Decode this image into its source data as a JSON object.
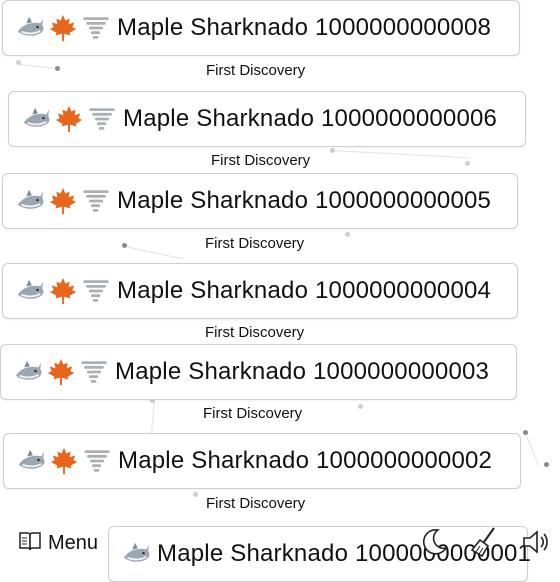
{
  "elements": [
    {
      "emojis": [
        "shark",
        "maple-leaf",
        "tornado"
      ],
      "name": "Maple Sharknado 1000000000008",
      "caption": "First Discovery"
    },
    {
      "emojis": [
        "shark",
        "maple-leaf",
        "tornado"
      ],
      "name": "Maple Sharknado 1000000000006",
      "caption": "First Discovery"
    },
    {
      "emojis": [
        "shark",
        "maple-leaf",
        "tornado"
      ],
      "name": "Maple Sharknado 1000000000005",
      "caption": "First Discovery"
    },
    {
      "emojis": [
        "shark",
        "maple-leaf",
        "tornado"
      ],
      "name": "Maple Sharknado 1000000000004",
      "caption": "First Discovery"
    },
    {
      "emojis": [
        "shark",
        "maple-leaf",
        "tornado"
      ],
      "name": "Maple Sharknado 1000000000003",
      "caption": "First Discovery"
    },
    {
      "emojis": [
        "shark",
        "maple-leaf",
        "tornado"
      ],
      "name": "Maple Sharknado 1000000000002",
      "caption": "First Discovery"
    },
    {
      "emojis": [
        "shark",
        "maple-leaf",
        "tornado"
      ],
      "name": "Maple Sharknado 1000000000001",
      "caption": ""
    }
  ],
  "toolbar": {
    "menu_label": "Menu",
    "menu_icon": "book-icon",
    "icons": [
      "moon-icon",
      "broom-icon",
      "speaker-icon"
    ]
  },
  "colors": {
    "border": "#c9cfd6",
    "text": "#111111",
    "shark": "#9aa7b3",
    "maple": "#e8651c",
    "tornado": "#a9b0b6"
  }
}
